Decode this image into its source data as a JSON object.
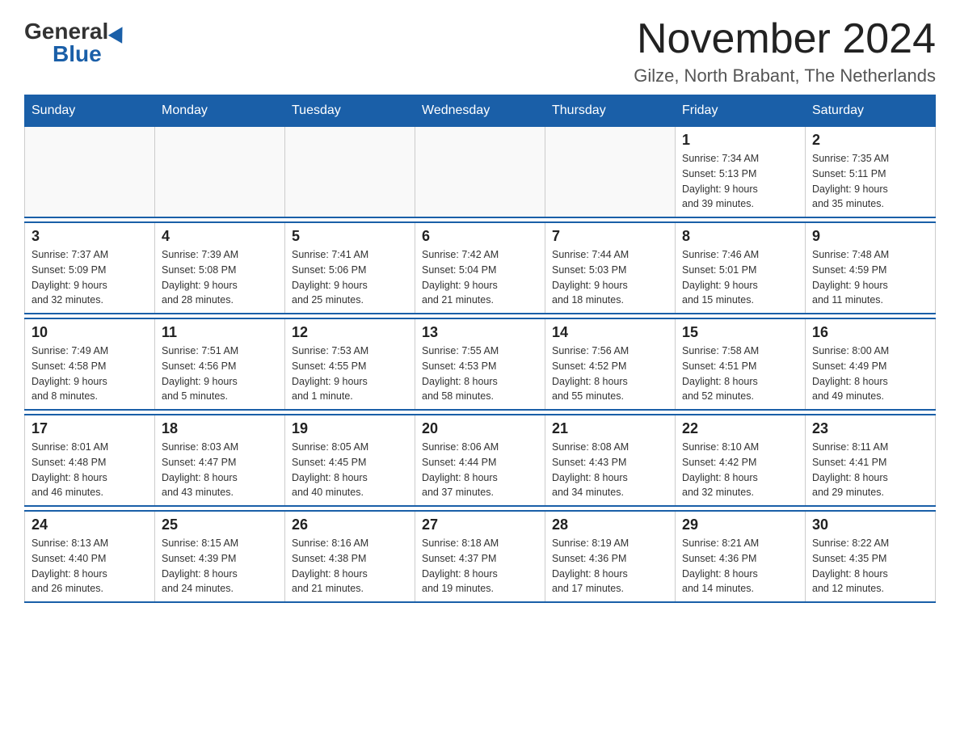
{
  "header": {
    "logo_general": "General",
    "logo_blue": "Blue",
    "month_title": "November 2024",
    "subtitle": "Gilze, North Brabant, The Netherlands"
  },
  "weekdays": [
    "Sunday",
    "Monday",
    "Tuesday",
    "Wednesday",
    "Thursday",
    "Friday",
    "Saturday"
  ],
  "weeks": [
    [
      {
        "day": "",
        "info": ""
      },
      {
        "day": "",
        "info": ""
      },
      {
        "day": "",
        "info": ""
      },
      {
        "day": "",
        "info": ""
      },
      {
        "day": "",
        "info": ""
      },
      {
        "day": "1",
        "info": "Sunrise: 7:34 AM\nSunset: 5:13 PM\nDaylight: 9 hours\nand 39 minutes."
      },
      {
        "day": "2",
        "info": "Sunrise: 7:35 AM\nSunset: 5:11 PM\nDaylight: 9 hours\nand 35 minutes."
      }
    ],
    [
      {
        "day": "3",
        "info": "Sunrise: 7:37 AM\nSunset: 5:09 PM\nDaylight: 9 hours\nand 32 minutes."
      },
      {
        "day": "4",
        "info": "Sunrise: 7:39 AM\nSunset: 5:08 PM\nDaylight: 9 hours\nand 28 minutes."
      },
      {
        "day": "5",
        "info": "Sunrise: 7:41 AM\nSunset: 5:06 PM\nDaylight: 9 hours\nand 25 minutes."
      },
      {
        "day": "6",
        "info": "Sunrise: 7:42 AM\nSunset: 5:04 PM\nDaylight: 9 hours\nand 21 minutes."
      },
      {
        "day": "7",
        "info": "Sunrise: 7:44 AM\nSunset: 5:03 PM\nDaylight: 9 hours\nand 18 minutes."
      },
      {
        "day": "8",
        "info": "Sunrise: 7:46 AM\nSunset: 5:01 PM\nDaylight: 9 hours\nand 15 minutes."
      },
      {
        "day": "9",
        "info": "Sunrise: 7:48 AM\nSunset: 4:59 PM\nDaylight: 9 hours\nand 11 minutes."
      }
    ],
    [
      {
        "day": "10",
        "info": "Sunrise: 7:49 AM\nSunset: 4:58 PM\nDaylight: 9 hours\nand 8 minutes."
      },
      {
        "day": "11",
        "info": "Sunrise: 7:51 AM\nSunset: 4:56 PM\nDaylight: 9 hours\nand 5 minutes."
      },
      {
        "day": "12",
        "info": "Sunrise: 7:53 AM\nSunset: 4:55 PM\nDaylight: 9 hours\nand 1 minute."
      },
      {
        "day": "13",
        "info": "Sunrise: 7:55 AM\nSunset: 4:53 PM\nDaylight: 8 hours\nand 58 minutes."
      },
      {
        "day": "14",
        "info": "Sunrise: 7:56 AM\nSunset: 4:52 PM\nDaylight: 8 hours\nand 55 minutes."
      },
      {
        "day": "15",
        "info": "Sunrise: 7:58 AM\nSunset: 4:51 PM\nDaylight: 8 hours\nand 52 minutes."
      },
      {
        "day": "16",
        "info": "Sunrise: 8:00 AM\nSunset: 4:49 PM\nDaylight: 8 hours\nand 49 minutes."
      }
    ],
    [
      {
        "day": "17",
        "info": "Sunrise: 8:01 AM\nSunset: 4:48 PM\nDaylight: 8 hours\nand 46 minutes."
      },
      {
        "day": "18",
        "info": "Sunrise: 8:03 AM\nSunset: 4:47 PM\nDaylight: 8 hours\nand 43 minutes."
      },
      {
        "day": "19",
        "info": "Sunrise: 8:05 AM\nSunset: 4:45 PM\nDaylight: 8 hours\nand 40 minutes."
      },
      {
        "day": "20",
        "info": "Sunrise: 8:06 AM\nSunset: 4:44 PM\nDaylight: 8 hours\nand 37 minutes."
      },
      {
        "day": "21",
        "info": "Sunrise: 8:08 AM\nSunset: 4:43 PM\nDaylight: 8 hours\nand 34 minutes."
      },
      {
        "day": "22",
        "info": "Sunrise: 8:10 AM\nSunset: 4:42 PM\nDaylight: 8 hours\nand 32 minutes."
      },
      {
        "day": "23",
        "info": "Sunrise: 8:11 AM\nSunset: 4:41 PM\nDaylight: 8 hours\nand 29 minutes."
      }
    ],
    [
      {
        "day": "24",
        "info": "Sunrise: 8:13 AM\nSunset: 4:40 PM\nDaylight: 8 hours\nand 26 minutes."
      },
      {
        "day": "25",
        "info": "Sunrise: 8:15 AM\nSunset: 4:39 PM\nDaylight: 8 hours\nand 24 minutes."
      },
      {
        "day": "26",
        "info": "Sunrise: 8:16 AM\nSunset: 4:38 PM\nDaylight: 8 hours\nand 21 minutes."
      },
      {
        "day": "27",
        "info": "Sunrise: 8:18 AM\nSunset: 4:37 PM\nDaylight: 8 hours\nand 19 minutes."
      },
      {
        "day": "28",
        "info": "Sunrise: 8:19 AM\nSunset: 4:36 PM\nDaylight: 8 hours\nand 17 minutes."
      },
      {
        "day": "29",
        "info": "Sunrise: 8:21 AM\nSunset: 4:36 PM\nDaylight: 8 hours\nand 14 minutes."
      },
      {
        "day": "30",
        "info": "Sunrise: 8:22 AM\nSunset: 4:35 PM\nDaylight: 8 hours\nand 12 minutes."
      }
    ]
  ],
  "colors": {
    "header_bg": "#1a5fa8",
    "header_text": "#ffffff",
    "accent": "#1a5fa8"
  }
}
